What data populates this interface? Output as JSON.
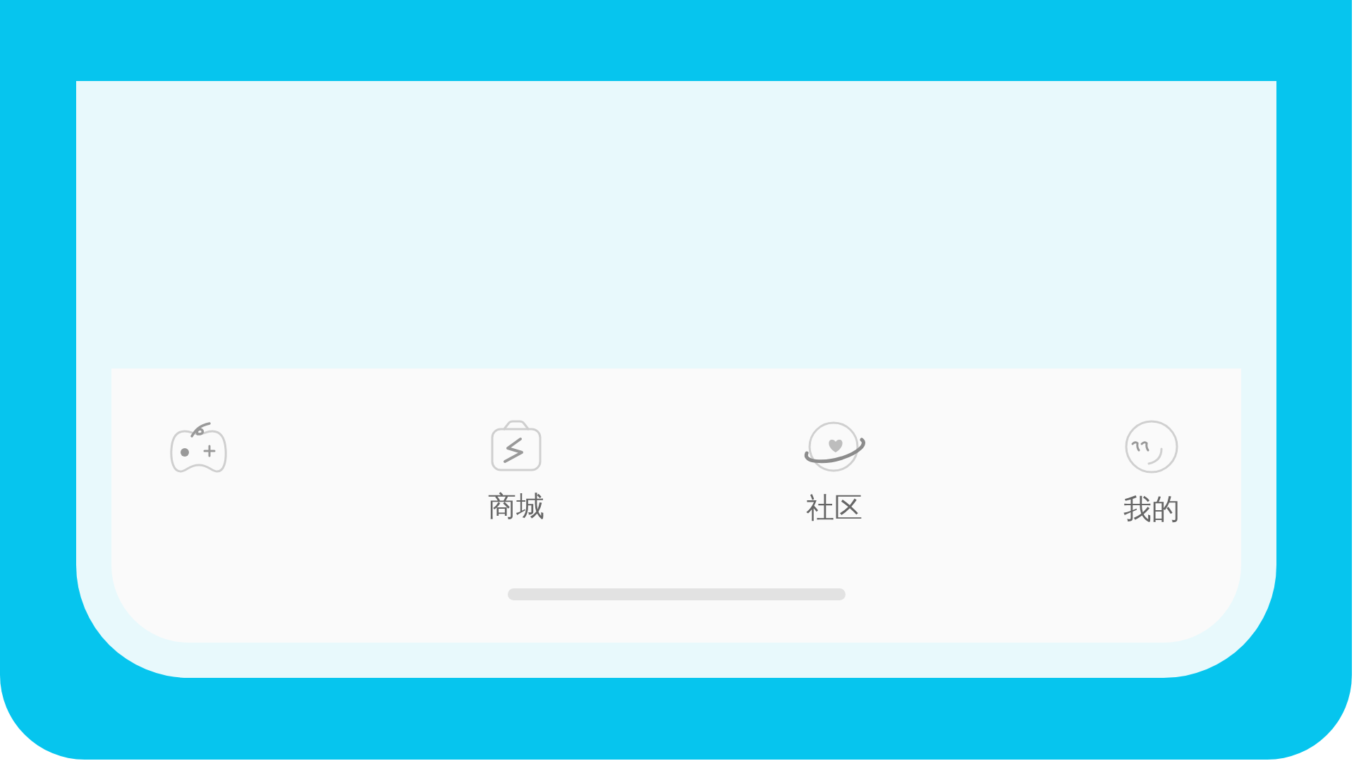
{
  "tab_bar": {
    "tabs": [
      {
        "kind": "game"
      },
      {
        "kind": "shop",
        "label": "商城"
      },
      {
        "kind": "planet",
        "label": "社区"
      },
      {
        "kind": "smile",
        "label": "我的"
      }
    ]
  }
}
